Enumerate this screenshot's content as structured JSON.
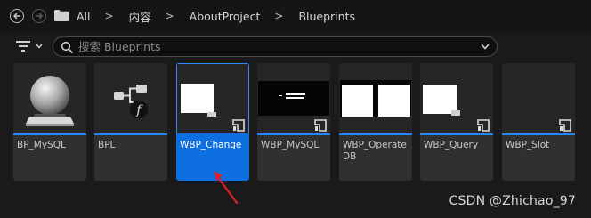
{
  "breadcrumb": {
    "items": [
      "All",
      "内容",
      "AboutProject",
      "Blueprints"
    ],
    "separator": ">"
  },
  "search": {
    "placeholder": "搜索 Blueprints",
    "value": ""
  },
  "assets": [
    {
      "name": "BP_MySQL",
      "thumbnail": "sphere",
      "selected": false
    },
    {
      "name": "BPL",
      "thumbnail": "function-library",
      "selected": false
    },
    {
      "name": "WBP_Change",
      "thumbnail": "widget-white",
      "selected": true
    },
    {
      "name": "WBP_MySQL",
      "thumbnail": "widget-black",
      "selected": false
    },
    {
      "name": "WBP_Operate DB",
      "thumbnail": "widget-split",
      "selected": false
    },
    {
      "name": "WBP_Query",
      "thumbnail": "widget-white",
      "selected": false
    },
    {
      "name": "WBP_Slot",
      "thumbnail": "widget-empty",
      "selected": false
    }
  ],
  "watermark": "CSDN @Zhichao_97",
  "colors": {
    "background": "#1a1a1a",
    "tile": "#303030",
    "selected": "#0d6fe0",
    "accent_bar": "#1e88ff",
    "annotation_arrow": "#e02020"
  }
}
